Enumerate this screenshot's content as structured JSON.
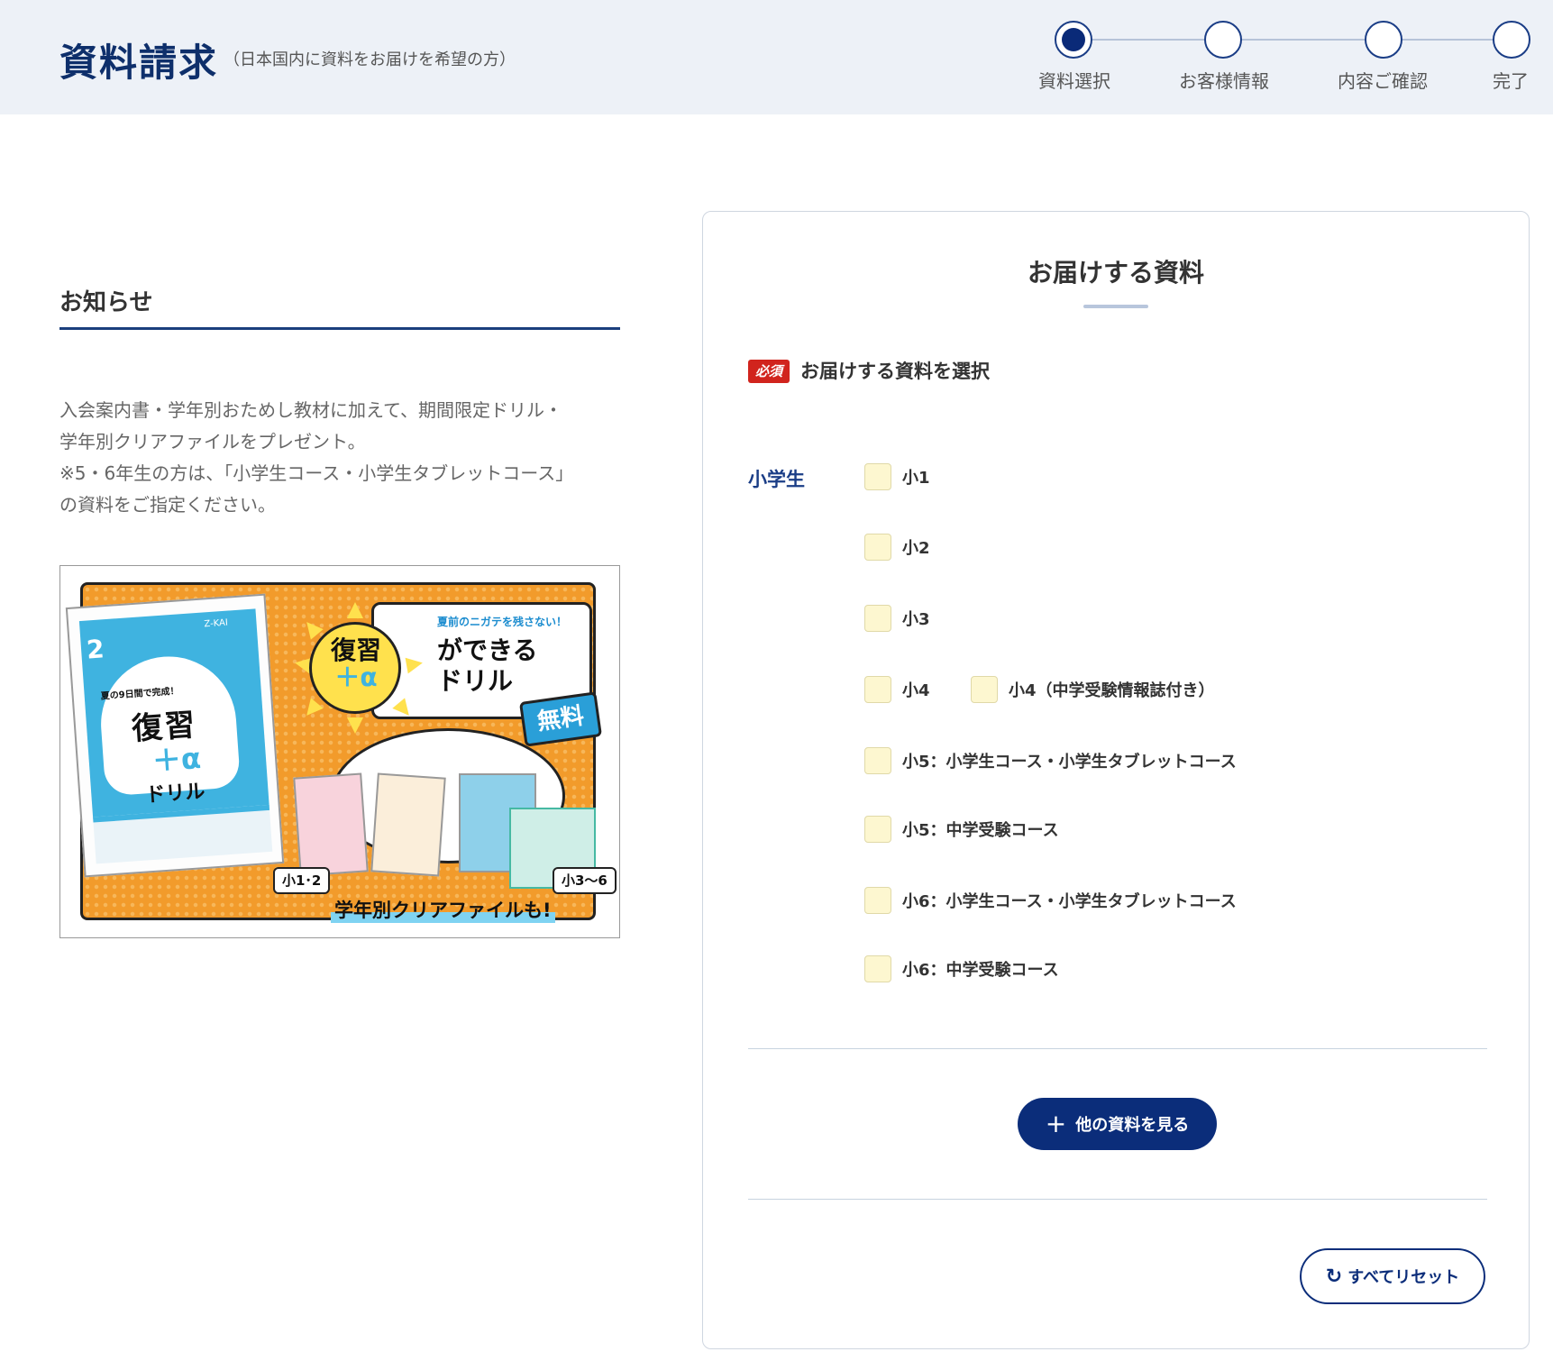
{
  "header": {
    "title": "資料請求",
    "subtitle": "（日本国内に資料をお届けを希望の方）",
    "steps": [
      {
        "label": "資料選択",
        "active": true
      },
      {
        "label": "お客様情報",
        "active": false
      },
      {
        "label": "内容ご確認",
        "active": false
      },
      {
        "label": "完了",
        "active": false
      }
    ]
  },
  "news": {
    "heading": "お知らせ",
    "lines": [
      "入会案内書・学年別おためし教材に加えて、期間限定ドリル・",
      "学年別クリアファイルをプレゼント。",
      "※5・6年生の方は、「小学生コース・小学生タブレットコース」",
      "の資料をご指定ください。"
    ]
  },
  "promo": {
    "book_grade": "2",
    "book_brand": "Z-KAI",
    "book_tag": "夏の9日間で完成！",
    "book_title": "復習",
    "book_alpha": "＋α",
    "book_drill": "ドリル",
    "sun_text": "復習",
    "sun_alpha": "＋α",
    "banner_small": "夏前のニガテを残さない！",
    "banner_line1": "ができる",
    "banner_line2": "ドリル",
    "free": "無料",
    "tag_left": "小1･2",
    "tag_right": "小3～6",
    "caption": "学年別クリアファイルも!"
  },
  "panel": {
    "title": "お届けする資料",
    "required_badge": "必須",
    "required_label": "お届けする資料を選択",
    "group_label": "小学生",
    "options": {
      "o1": "小1",
      "o2": "小2",
      "o3": "小3",
      "o4": "小4",
      "o4b": "小4（中学受験情報誌付き）",
      "o5a": "小5：小学生コース・小学生タブレットコース",
      "o5b": "小5：中学受験コース",
      "o6a": "小6：小学生コース・小学生タブレットコース",
      "o6b": "小6：中学受験コース"
    },
    "more_button": "他の資料を見る",
    "more_icon": "plus-icon",
    "reset_button": "すべてリセット",
    "reset_icon": "refresh-icon"
  },
  "colors": {
    "navy": "#0b2d7a",
    "header_bg": "#edf1f7",
    "required_red": "#d1241d",
    "checkbox_fill": "#fdf7d0"
  }
}
